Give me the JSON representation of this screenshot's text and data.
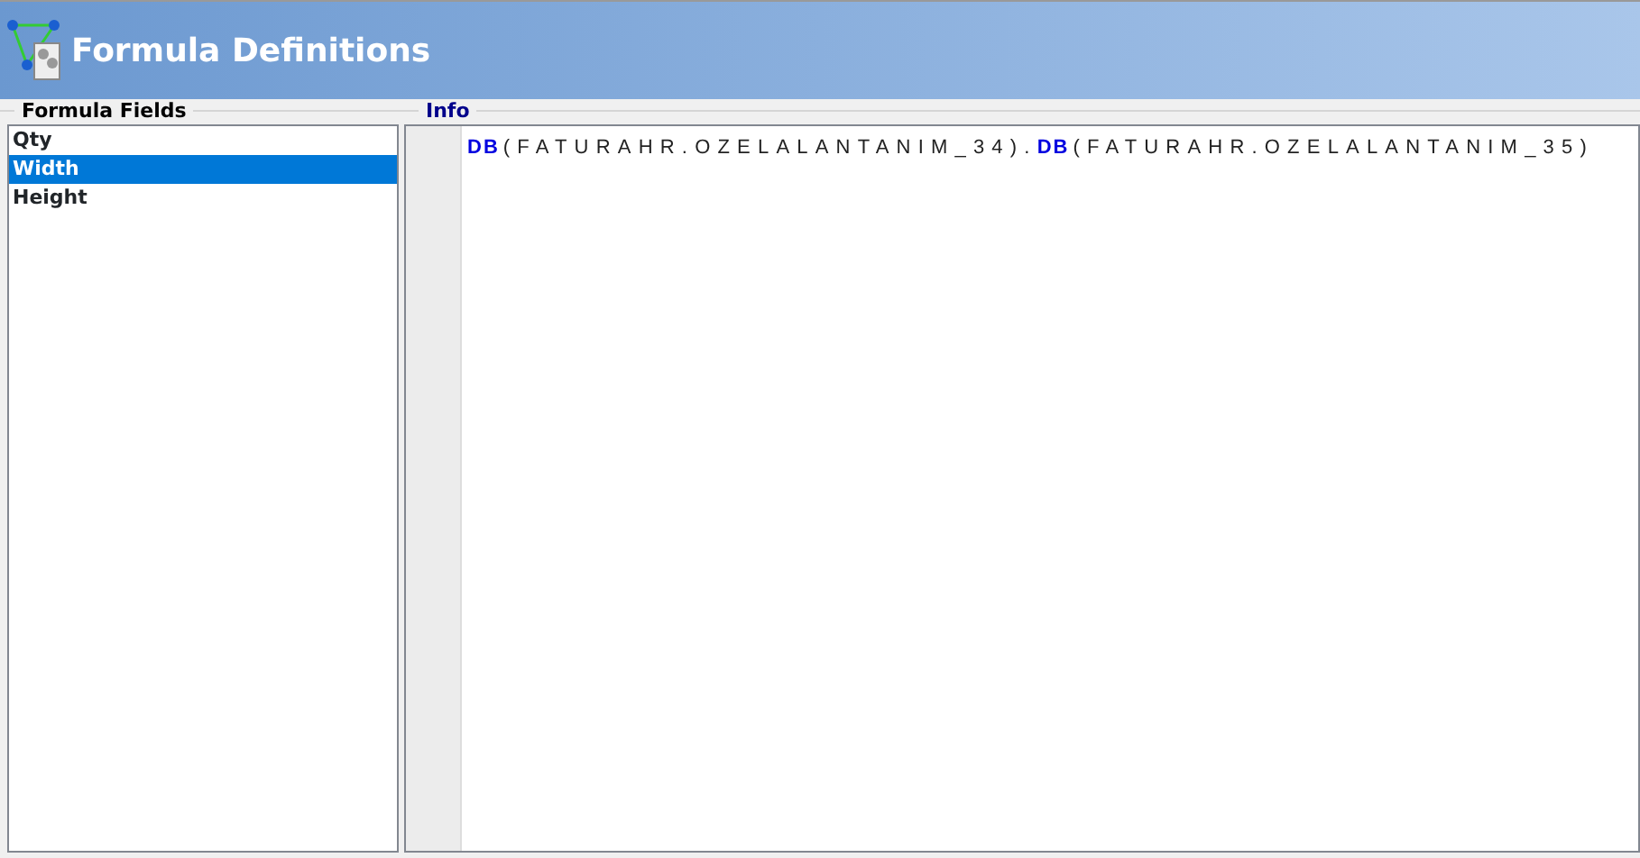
{
  "window": {
    "title": "Formula Definitions"
  },
  "formula_fields": {
    "title": "Formula Fields",
    "items": [
      {
        "label": "Qty",
        "selected": false
      },
      {
        "label": "Width",
        "selected": true
      },
      {
        "label": "Height",
        "selected": false
      }
    ]
  },
  "info": {
    "title": "Info",
    "tokens": [
      {
        "kind": "keyword",
        "text": "DB"
      },
      {
        "kind": "plain",
        "text": "(FATURAHR.OZELALANTANIM_34)."
      },
      {
        "kind": "keyword",
        "text": "DB"
      },
      {
        "kind": "plain",
        "text": "(FATURAHR.OZELALANTANIM_35)"
      }
    ]
  }
}
